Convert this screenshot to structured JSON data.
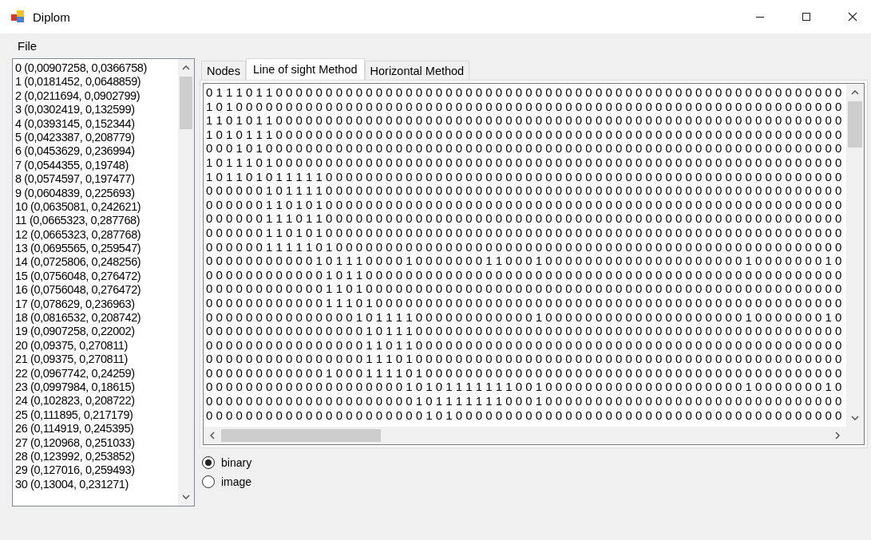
{
  "window": {
    "title": "Diplom"
  },
  "menu": [
    {
      "label": "File"
    }
  ],
  "nodes": [
    "0 (0,00907258, 0,0366758)",
    "1 (0,0181452, 0,0648859)",
    "2 (0,0211694, 0,0902799)",
    "3 (0,0302419, 0,132599)",
    "4 (0,0393145, 0,152344)",
    "5 (0,0423387, 0,208779)",
    "6 (0,0453629, 0,236994)",
    "7 (0,0544355, 0,19748)",
    "8 (0,0574597, 0,197477)",
    "9 (0,0604839, 0,225693)",
    "10 (0,0635081, 0,242621)",
    "11 (0,0665323, 0,287768)",
    "12 (0,0665323, 0,287768)",
    "13 (0,0695565, 0,259547)",
    "14 (0,0725806, 0,248256)",
    "15 (0,0756048, 0,276472)",
    "16 (0,0756048, 0,276472)",
    "17 (0,078629, 0,236963)",
    "18 (0,0816532, 0,208742)",
    "19 (0,0907258, 0,22002)",
    "20 (0,09375, 0,270811)",
    "21 (0,09375, 0,270811)",
    "22 (0,0967742, 0,24259)",
    "23 (0,0997984, 0,18615)",
    "24 (0,102823, 0,208722)",
    "25 (0,111895, 0,217179)",
    "26 (0,114919, 0,245395)",
    "27 (0,120968, 0,251033)",
    "28 (0,123992, 0,253852)",
    "29 (0,127016, 0,259493)",
    "30 (0,13004, 0,231271)"
  ],
  "tabs": [
    {
      "label": "Nodes",
      "selected": false
    },
    {
      "label": "Line of sight Method",
      "selected": true
    },
    {
      "label": "Horizontal Method",
      "selected": false
    }
  ],
  "matrix": {
    "rows": [
      "0 1 1 1 0 1 1 0 0 0 0 0 0 0 0 0 0 0 0 0 0 0 0 0 0 0 0 0 0 0 0 0 0 0 0 0 0 0 0 0 0 0 0 0 0 0 0 0 0 0 0 0 0 0 0 0 0 0 0 0 0 0 0 0",
      "1 0 1 0 0 0 0 0 0 0 0 0 0 0 0 0 0 0 0 0 0 0 0 0 0 0 0 0 0 0 0 0 0 0 0 0 0 0 0 0 0 0 0 0 0 0 0 0 0 0 0 0 0 0 0 0 0 0 0 0 0 0 0 0",
      "1 1 0 1 0 1 1 0 0 0 0 0 0 0 0 0 0 0 0 0 0 0 0 0 0 0 0 0 0 0 0 0 0 0 0 0 0 0 0 0 0 0 0 0 0 0 0 0 0 0 0 0 0 0 0 0 0 0 0 0 0 0 0 0",
      "1 0 1 0 1 1 1 0 0 0 0 0 0 0 0 0 0 0 0 0 0 0 0 0 0 0 0 0 0 0 0 0 0 0 0 0 0 0 0 0 0 0 0 0 0 0 0 0 0 0 0 0 0 0 0 0 0 0 0 0 0 0 0 0",
      "0 0 0 1 0 1 0 0 0 0 0 0 0 0 0 0 0 0 0 0 0 0 0 0 0 0 0 0 0 0 0 0 0 0 0 0 0 0 0 0 0 0 0 0 0 0 0 0 0 0 0 0 0 0 0 0 0 0 0 0 0 0 0 0",
      "1 0 1 1 1 0 1 0 0 0 0 0 0 0 0 0 0 0 0 0 0 0 0 0 0 0 0 0 0 0 0 0 0 0 0 0 0 0 0 0 0 0 0 0 0 0 0 0 0 0 0 0 0 0 0 0 0 0 0 0 0 0 0 0",
      "1 0 1 1 0 1 0 1 1 1 1 1 0 0 0 0 0 0 0 0 0 0 0 0 0 0 0 0 0 0 0 0 0 0 0 0 0 0 0 0 0 0 0 0 0 0 0 0 0 0 0 0 0 0 0 0 0 0 0 0 0 0 0 0",
      "0 0 0 0 0 0 1 0 1 1 1 1 0 0 0 0 0 0 0 0 0 0 0 0 0 0 0 0 0 0 0 0 0 0 0 0 0 0 0 0 0 0 0 0 0 0 0 0 0 0 0 0 0 0 0 0 0 0 0 0 0 0 0 0",
      "0 0 0 0 0 0 1 1 0 1 0 1 0 0 0 0 0 0 0 0 0 0 0 0 0 0 0 0 0 0 0 0 0 0 0 0 0 0 0 0 0 0 0 0 0 0 0 0 0 0 0 0 0 0 0 0 0 0 0 0 0 0 0 0",
      "0 0 0 0 0 0 1 1 1 0 1 1 0 0 0 0 0 0 0 0 0 0 0 0 0 0 0 0 0 0 0 0 0 0 0 0 0 0 0 0 0 0 0 0 0 0 0 0 0 0 0 0 0 0 0 0 0 0 0 0 0 0 0 0",
      "0 0 0 0 0 0 1 1 0 1 0 1 0 0 0 0 0 0 0 0 0 0 0 0 0 0 0 0 0 0 0 0 0 0 0 0 0 0 0 0 0 0 0 0 0 0 0 0 0 0 0 0 0 0 0 0 0 0 0 0 0 0 0 0",
      "0 0 0 0 0 0 1 1 1 1 1 0 1 0 0 0 0 0 0 0 0 0 0 0 0 0 0 0 0 0 0 0 0 0 0 0 0 0 0 0 0 0 0 0 0 0 0 0 0 0 0 0 0 0 0 0 0 0 0 0 0 0 0 0",
      "0 0 0 0 0 0 0 0 0 0 0 1 0 1 1 1 0 0 0 0 1 0 0 0 0 0 0 0 1 1 0 0 0 1 0 0 0 0 0 0 0 0 0 0 0 0 0 0 0 0 0 0 0 0 1 0 0 0 0 0 0 0 1 0",
      "0 0 0 0 0 0 0 0 0 0 0 0 1 0 1 1 0 0 0 0 0 0 0 0 0 0 0 0 0 0 0 0 0 0 0 0 0 0 0 0 0 0 0 0 0 0 0 0 0 0 0 0 0 0 0 0 0 0 0 0 0 0 0 0",
      "0 0 0 0 0 0 0 0 0 0 0 0 1 1 0 1 0 0 0 0 0 0 0 0 0 0 0 0 0 0 0 0 0 0 0 0 0 0 0 0 0 0 0 0 0 0 0 0 0 0 0 0 0 0 0 0 0 0 0 0 0 0 0 0",
      "0 0 0 0 0 0 0 0 0 0 0 0 1 1 1 0 1 0 0 0 0 0 0 0 0 0 0 0 0 0 0 0 0 0 0 0 0 0 0 0 0 0 0 0 0 0 0 0 0 0 0 0 0 0 0 0 0 0 0 0 0 0 0 0",
      "0 0 0 0 0 0 0 0 0 0 0 0 0 0 0 1 0 1 1 1 1 0 0 0 0 0 0 0 0 0 0 0 0 1 0 0 0 0 0 0 0 0 0 0 0 0 0 0 0 0 0 0 0 0 1 0 0 0 0 0 0 0 1 0",
      "0 0 0 0 0 0 0 0 0 0 0 0 0 0 0 0 1 0 1 1 1 0 0 0 0 0 0 0 0 0 0 0 0 0 0 0 0 0 0 0 0 0 0 0 0 0 0 0 0 0 0 0 0 0 0 0 0 0 0 0 0 0 0 0",
      "0 0 0 0 0 0 0 0 0 0 0 0 0 0 0 0 1 1 0 1 1 0 0 0 0 0 0 0 0 0 0 0 0 0 0 0 0 0 0 0 0 0 0 0 0 0 0 0 0 0 0 0 0 0 0 0 0 0 0 0 0 0 0 0",
      "0 0 0 0 0 0 0 0 0 0 0 0 0 0 0 0 1 1 1 0 1 0 0 0 0 0 0 0 0 0 0 0 0 0 0 0 0 0 0 0 0 0 0 0 0 0 0 0 0 0 0 0 0 0 0 0 0 0 0 0 0 0 0 0",
      "0 0 0 0 0 0 0 0 0 0 0 0 1 0 0 0 1 1 1 1 0 1 0 0 0 0 0 0 0 0 0 0 0 0 0 0 0 0 0 0 0 0 0 0 0 0 0 0 0 0 0 0 0 0 0 0 0 0 0 0 0 0 0 0",
      "0 0 0 0 0 0 0 0 0 0 0 0 0 0 0 0 0 0 0 0 1 0 1 0 1 1 1 1 1 1 1 0 0 1 0 0 0 0 0 0 0 0 0 0 0 0 0 0 0 0 0 0 0 0 1 0 0 0 0 0 0 0 1 0",
      "0 0 0 0 0 0 0 0 0 0 0 0 0 0 0 0 0 0 0 0 0 1 0 1 1 1 1 1 1 1 0 0 0 1 0 0 0 0 0 0 0 0 0 0 0 0 0 0 0 0 0 0 0 0 0 0 0 0 0 0 0 0 0 0",
      "0 0 0 0 0 0 0 0 0 0 0 0 0 0 0 0 0 0 0 0 0 0 1 0 1 0 0 0 0 0 0 0 0 0 0 0 0 0 0 0 0 0 0 0 0 0 0 0 0 0 0 0 0 0 0 0 0 0 0 0 0 0 0 0"
    ]
  },
  "display_mode": [
    {
      "label": "binary",
      "selected": true
    },
    {
      "label": "image",
      "selected": false
    }
  ]
}
